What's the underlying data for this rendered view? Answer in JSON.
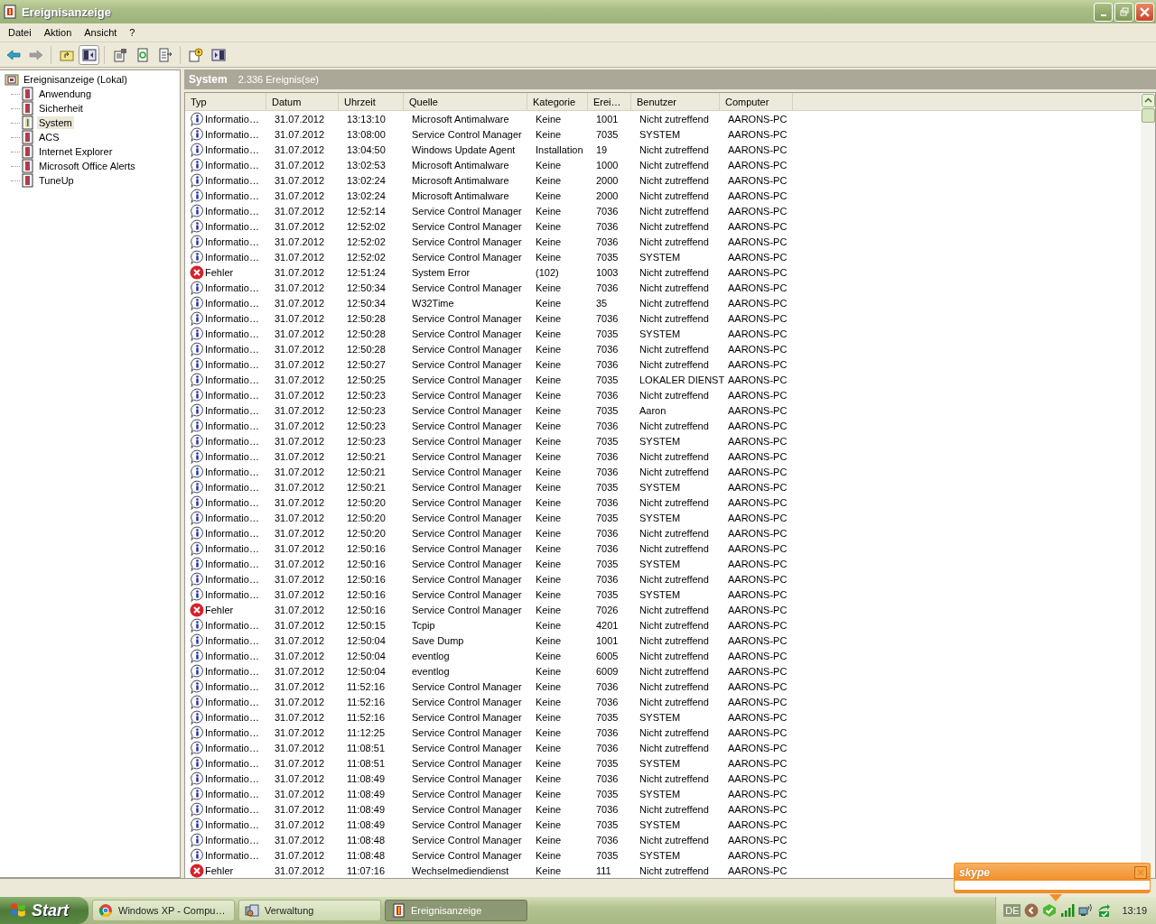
{
  "window": {
    "title": "Ereignisanzeige"
  },
  "menu": [
    "Datei",
    "Aktion",
    "Ansicht",
    "?"
  ],
  "toolbar": [
    {
      "kind": "back",
      "disabled": false
    },
    {
      "kind": "forward",
      "disabled": true
    },
    {
      "kind": "sep"
    },
    {
      "kind": "up"
    },
    {
      "kind": "tree",
      "pressed": true
    },
    {
      "kind": "sep"
    },
    {
      "kind": "properties"
    },
    {
      "kind": "refresh"
    },
    {
      "kind": "export"
    },
    {
      "kind": "sep"
    },
    {
      "kind": "help"
    },
    {
      "kind": "panel"
    }
  ],
  "tree": {
    "label": "Ereignisanzeige (Lokal)",
    "children": [
      {
        "label": "Anwendung",
        "selected": false
      },
      {
        "label": "Sicherheit",
        "selected": false
      },
      {
        "label": "System",
        "selected": true
      },
      {
        "label": "ACS",
        "selected": false
      },
      {
        "label": "Internet Explorer",
        "selected": false
      },
      {
        "label": "Microsoft Office Alerts",
        "selected": false
      },
      {
        "label": "TuneUp",
        "selected": false
      }
    ]
  },
  "panel": {
    "title": "System",
    "count": "2.336 Ereignis(se)"
  },
  "table": {
    "columns": [
      "Typ",
      "Datum",
      "Uhrzeit",
      "Quelle",
      "Kategorie",
      "Erei…",
      "Benutzer",
      "Computer"
    ],
    "rows": [
      {
        "kind": "info",
        "cells": [
          "Informatio…",
          "31.07.2012",
          "13:13:10",
          "Microsoft Antimalware",
          "Keine",
          "1001",
          "Nicht zutreffend",
          "AARONS-PC"
        ]
      },
      {
        "kind": "info",
        "cells": [
          "Informatio…",
          "31.07.2012",
          "13:08:00",
          "Service Control Manager",
          "Keine",
          "7035",
          "SYSTEM",
          "AARONS-PC"
        ]
      },
      {
        "kind": "info",
        "cells": [
          "Informatio…",
          "31.07.2012",
          "13:04:50",
          "Windows Update Agent",
          "Installation",
          "19",
          "Nicht zutreffend",
          "AARONS-PC"
        ]
      },
      {
        "kind": "info",
        "cells": [
          "Informatio…",
          "31.07.2012",
          "13:02:53",
          "Microsoft Antimalware",
          "Keine",
          "1000",
          "Nicht zutreffend",
          "AARONS-PC"
        ]
      },
      {
        "kind": "info",
        "cells": [
          "Informatio…",
          "31.07.2012",
          "13:02:24",
          "Microsoft Antimalware",
          "Keine",
          "2000",
          "Nicht zutreffend",
          "AARONS-PC"
        ]
      },
      {
        "kind": "info",
        "cells": [
          "Informatio…",
          "31.07.2012",
          "13:02:24",
          "Microsoft Antimalware",
          "Keine",
          "2000",
          "Nicht zutreffend",
          "AARONS-PC"
        ]
      },
      {
        "kind": "info",
        "cells": [
          "Informatio…",
          "31.07.2012",
          "12:52:14",
          "Service Control Manager",
          "Keine",
          "7036",
          "Nicht zutreffend",
          "AARONS-PC"
        ]
      },
      {
        "kind": "info",
        "cells": [
          "Informatio…",
          "31.07.2012",
          "12:52:02",
          "Service Control Manager",
          "Keine",
          "7036",
          "Nicht zutreffend",
          "AARONS-PC"
        ]
      },
      {
        "kind": "info",
        "cells": [
          "Informatio…",
          "31.07.2012",
          "12:52:02",
          "Service Control Manager",
          "Keine",
          "7036",
          "Nicht zutreffend",
          "AARONS-PC"
        ]
      },
      {
        "kind": "info",
        "cells": [
          "Informatio…",
          "31.07.2012",
          "12:52:02",
          "Service Control Manager",
          "Keine",
          "7035",
          "SYSTEM",
          "AARONS-PC"
        ]
      },
      {
        "kind": "error",
        "cells": [
          "Fehler",
          "31.07.2012",
          "12:51:24",
          "System Error",
          "(102)",
          "1003",
          "Nicht zutreffend",
          "AARONS-PC"
        ]
      },
      {
        "kind": "info",
        "cells": [
          "Informatio…",
          "31.07.2012",
          "12:50:34",
          "Service Control Manager",
          "Keine",
          "7036",
          "Nicht zutreffend",
          "AARONS-PC"
        ]
      },
      {
        "kind": "info",
        "cells": [
          "Informatio…",
          "31.07.2012",
          "12:50:34",
          "W32Time",
          "Keine",
          "35",
          "Nicht zutreffend",
          "AARONS-PC"
        ]
      },
      {
        "kind": "info",
        "cells": [
          "Informatio…",
          "31.07.2012",
          "12:50:28",
          "Service Control Manager",
          "Keine",
          "7036",
          "Nicht zutreffend",
          "AARONS-PC"
        ]
      },
      {
        "kind": "info",
        "cells": [
          "Informatio…",
          "31.07.2012",
          "12:50:28",
          "Service Control Manager",
          "Keine",
          "7035",
          "SYSTEM",
          "AARONS-PC"
        ]
      },
      {
        "kind": "info",
        "cells": [
          "Informatio…",
          "31.07.2012",
          "12:50:28",
          "Service Control Manager",
          "Keine",
          "7036",
          "Nicht zutreffend",
          "AARONS-PC"
        ]
      },
      {
        "kind": "info",
        "cells": [
          "Informatio…",
          "31.07.2012",
          "12:50:27",
          "Service Control Manager",
          "Keine",
          "7036",
          "Nicht zutreffend",
          "AARONS-PC"
        ]
      },
      {
        "kind": "info",
        "cells": [
          "Informatio…",
          "31.07.2012",
          "12:50:25",
          "Service Control Manager",
          "Keine",
          "7035",
          "LOKALER DIENST",
          "AARONS-PC"
        ]
      },
      {
        "kind": "info",
        "cells": [
          "Informatio…",
          "31.07.2012",
          "12:50:23",
          "Service Control Manager",
          "Keine",
          "7036",
          "Nicht zutreffend",
          "AARONS-PC"
        ]
      },
      {
        "kind": "info",
        "cells": [
          "Informatio…",
          "31.07.2012",
          "12:50:23",
          "Service Control Manager",
          "Keine",
          "7035",
          "Aaron",
          "AARONS-PC"
        ]
      },
      {
        "kind": "info",
        "cells": [
          "Informatio…",
          "31.07.2012",
          "12:50:23",
          "Service Control Manager",
          "Keine",
          "7036",
          "Nicht zutreffend",
          "AARONS-PC"
        ]
      },
      {
        "kind": "info",
        "cells": [
          "Informatio…",
          "31.07.2012",
          "12:50:23",
          "Service Control Manager",
          "Keine",
          "7035",
          "SYSTEM",
          "AARONS-PC"
        ]
      },
      {
        "kind": "info",
        "cells": [
          "Informatio…",
          "31.07.2012",
          "12:50:21",
          "Service Control Manager",
          "Keine",
          "7036",
          "Nicht zutreffend",
          "AARONS-PC"
        ]
      },
      {
        "kind": "info",
        "cells": [
          "Informatio…",
          "31.07.2012",
          "12:50:21",
          "Service Control Manager",
          "Keine",
          "7036",
          "Nicht zutreffend",
          "AARONS-PC"
        ]
      },
      {
        "kind": "info",
        "cells": [
          "Informatio…",
          "31.07.2012",
          "12:50:21",
          "Service Control Manager",
          "Keine",
          "7035",
          "SYSTEM",
          "AARONS-PC"
        ]
      },
      {
        "kind": "info",
        "cells": [
          "Informatio…",
          "31.07.2012",
          "12:50:20",
          "Service Control Manager",
          "Keine",
          "7036",
          "Nicht zutreffend",
          "AARONS-PC"
        ]
      },
      {
        "kind": "info",
        "cells": [
          "Informatio…",
          "31.07.2012",
          "12:50:20",
          "Service Control Manager",
          "Keine",
          "7035",
          "SYSTEM",
          "AARONS-PC"
        ]
      },
      {
        "kind": "info",
        "cells": [
          "Informatio…",
          "31.07.2012",
          "12:50:20",
          "Service Control Manager",
          "Keine",
          "7036",
          "Nicht zutreffend",
          "AARONS-PC"
        ]
      },
      {
        "kind": "info",
        "cells": [
          "Informatio…",
          "31.07.2012",
          "12:50:16",
          "Service Control Manager",
          "Keine",
          "7036",
          "Nicht zutreffend",
          "AARONS-PC"
        ]
      },
      {
        "kind": "info",
        "cells": [
          "Informatio…",
          "31.07.2012",
          "12:50:16",
          "Service Control Manager",
          "Keine",
          "7035",
          "SYSTEM",
          "AARONS-PC"
        ]
      },
      {
        "kind": "info",
        "cells": [
          "Informatio…",
          "31.07.2012",
          "12:50:16",
          "Service Control Manager",
          "Keine",
          "7036",
          "Nicht zutreffend",
          "AARONS-PC"
        ]
      },
      {
        "kind": "info",
        "cells": [
          "Informatio…",
          "31.07.2012",
          "12:50:16",
          "Service Control Manager",
          "Keine",
          "7035",
          "SYSTEM",
          "AARONS-PC"
        ]
      },
      {
        "kind": "error",
        "cells": [
          "Fehler",
          "31.07.2012",
          "12:50:16",
          "Service Control Manager",
          "Keine",
          "7026",
          "Nicht zutreffend",
          "AARONS-PC"
        ]
      },
      {
        "kind": "info",
        "cells": [
          "Informatio…",
          "31.07.2012",
          "12:50:15",
          "Tcpip",
          "Keine",
          "4201",
          "Nicht zutreffend",
          "AARONS-PC"
        ]
      },
      {
        "kind": "info",
        "cells": [
          "Informatio…",
          "31.07.2012",
          "12:50:04",
          "Save Dump",
          "Keine",
          "1001",
          "Nicht zutreffend",
          "AARONS-PC"
        ]
      },
      {
        "kind": "info",
        "cells": [
          "Informatio…",
          "31.07.2012",
          "12:50:04",
          "eventlog",
          "Keine",
          "6005",
          "Nicht zutreffend",
          "AARONS-PC"
        ]
      },
      {
        "kind": "info",
        "cells": [
          "Informatio…",
          "31.07.2012",
          "12:50:04",
          "eventlog",
          "Keine",
          "6009",
          "Nicht zutreffend",
          "AARONS-PC"
        ]
      },
      {
        "kind": "info",
        "cells": [
          "Informatio…",
          "31.07.2012",
          "11:52:16",
          "Service Control Manager",
          "Keine",
          "7036",
          "Nicht zutreffend",
          "AARONS-PC"
        ]
      },
      {
        "kind": "info",
        "cells": [
          "Informatio…",
          "31.07.2012",
          "11:52:16",
          "Service Control Manager",
          "Keine",
          "7036",
          "Nicht zutreffend",
          "AARONS-PC"
        ]
      },
      {
        "kind": "info",
        "cells": [
          "Informatio…",
          "31.07.2012",
          "11:52:16",
          "Service Control Manager",
          "Keine",
          "7035",
          "SYSTEM",
          "AARONS-PC"
        ]
      },
      {
        "kind": "info",
        "cells": [
          "Informatio…",
          "31.07.2012",
          "11:12:25",
          "Service Control Manager",
          "Keine",
          "7036",
          "Nicht zutreffend",
          "AARONS-PC"
        ]
      },
      {
        "kind": "info",
        "cells": [
          "Informatio…",
          "31.07.2012",
          "11:08:51",
          "Service Control Manager",
          "Keine",
          "7036",
          "Nicht zutreffend",
          "AARONS-PC"
        ]
      },
      {
        "kind": "info",
        "cells": [
          "Informatio…",
          "31.07.2012",
          "11:08:51",
          "Service Control Manager",
          "Keine",
          "7035",
          "SYSTEM",
          "AARONS-PC"
        ]
      },
      {
        "kind": "info",
        "cells": [
          "Informatio…",
          "31.07.2012",
          "11:08:49",
          "Service Control Manager",
          "Keine",
          "7036",
          "Nicht zutreffend",
          "AARONS-PC"
        ]
      },
      {
        "kind": "info",
        "cells": [
          "Informatio…",
          "31.07.2012",
          "11:08:49",
          "Service Control Manager",
          "Keine",
          "7035",
          "SYSTEM",
          "AARONS-PC"
        ]
      },
      {
        "kind": "info",
        "cells": [
          "Informatio…",
          "31.07.2012",
          "11:08:49",
          "Service Control Manager",
          "Keine",
          "7036",
          "Nicht zutreffend",
          "AARONS-PC"
        ]
      },
      {
        "kind": "info",
        "cells": [
          "Informatio…",
          "31.07.2012",
          "11:08:49",
          "Service Control Manager",
          "Keine",
          "7035",
          "SYSTEM",
          "AARONS-PC"
        ]
      },
      {
        "kind": "info",
        "cells": [
          "Informatio…",
          "31.07.2012",
          "11:08:48",
          "Service Control Manager",
          "Keine",
          "7036",
          "Nicht zutreffend",
          "AARONS-PC"
        ]
      },
      {
        "kind": "info",
        "cells": [
          "Informatio…",
          "31.07.2012",
          "11:08:48",
          "Service Control Manager",
          "Keine",
          "7035",
          "SYSTEM",
          "AARONS-PC"
        ]
      },
      {
        "kind": "error",
        "cells": [
          "Fehler",
          "31.07.2012",
          "11:07:16",
          "Wechselmediendienst",
          "Keine",
          "111",
          "Nicht zutreffend",
          "AARONS-PC"
        ]
      }
    ]
  },
  "notification": {
    "logo": "skype"
  },
  "taskbar": {
    "start": "Start",
    "tasks": [
      {
        "kind": "browser",
        "label": "Windows XP - Compu…",
        "selected": false
      },
      {
        "kind": "tools",
        "label": "Verwaltung",
        "selected": false
      },
      {
        "kind": "events",
        "label": "Ereignisanzeige",
        "selected": true
      }
    ],
    "language": "DE",
    "clock": "13:19"
  }
}
